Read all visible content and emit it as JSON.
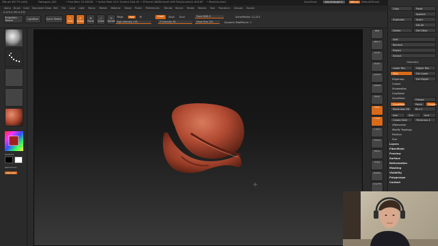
{
  "titlebar": {
    "app_title": "ZBrush 4R7 P3 (x64)",
    "doc_name": "Fatroopan_002",
    "status_items": [
      "• Free Mem 13.035GB",
      "• Active Mem 411",
      "• Scratch Disk 43",
      "• ZTime≡1.684",
      "Timer≡0.043",
      "• PolyCount≡11.618 KP",
      "• MeshCount≡1"
    ],
    "quicksave": "QuickSave",
    "seethrough": "See-through 0",
    "menus_btn": "Menus",
    "defaultzscript": "DefaultZScript"
  },
  "menubar": {
    "items": [
      "Alpha",
      "Brush",
      "Color",
      "Document",
      "Draw",
      "Edit",
      "File",
      "Layer",
      "Light",
      "Macro",
      "Marker",
      "Material",
      "Movie",
      "Picker",
      "Preferences",
      "Render",
      "Stencil",
      "Stroke",
      "Texture",
      "Tool",
      "Transform",
      "Zplugin",
      "Zscript"
    ]
  },
  "coords": "-0.475,0.785,0.378",
  "toolbar": {
    "projection_master": "Projection Master",
    "lightbox": "LightBox",
    "quick_sketch": "Quick Sketch",
    "edit": "Edit",
    "draw": "Draw",
    "move": "Move",
    "scale": "Scale",
    "rotate": "Rotate",
    "mrgb": "Mrgb",
    "rgb": "Rgb",
    "m": "M",
    "zadd": "Zadd",
    "zsub": "Zsub",
    "zcut": "Zcut",
    "rgb_intensity": "Rgb Intensity 100",
    "z_intensity": "Z Intensity 36",
    "focal_shift": "Focal Shift 0",
    "draw_size": "Draw Size 122",
    "dynamic": "Dynamic",
    "active_points": "ActivePoints: 11,213",
    "total_points": "TotalPoints: 1"
  },
  "leftshelf": {
    "gradient": "Gradient",
    "switch_color": "SwitchColor",
    "alternate": "Alternate"
  },
  "rightcol": {
    "icons": [
      "BPR",
      "SPix 3",
      "Scroll",
      "Zoom",
      "Actual",
      "AAHalf",
      "Persp",
      "Floor",
      "Local",
      "L.Sym",
      "Frame",
      "Move",
      "Scale",
      "Rotate",
      "Line Fill",
      "Transp",
      "Ghost",
      "Solo",
      "Xpose"
    ]
  },
  "palette": {
    "top_buttons": [
      "Copy",
      "Paste",
      "Append",
      "Duplicate",
      "Insert",
      "Delete",
      "Del Other",
      "Del All",
      "Split",
      "Remesh",
      "Project",
      "Extract"
    ],
    "geometry": "Geometry",
    "geom_buttons": [
      "Lower Res",
      "Higher Res",
      "SDiv",
      "Del Lower",
      "Del Higher"
    ],
    "edgeloop": "EdgeLoop",
    "crease": "Crease",
    "shadowbox": "ShadowBox",
    "claypolish": "ClayPolish",
    "dynamesh_section": "DynaMesh",
    "dynamesh_btn": "DynaMesh",
    "groups": "Groups",
    "polish": "Polish",
    "blur": "Blur 2",
    "project_btn": "Project",
    "resolution": "Resolution 96",
    "add": "Add",
    "sub": "Sub",
    "and": "And",
    "create_shell": "Create Shell",
    "thickness": "Thickness 4",
    "zremesher": "ZRemesher",
    "modify_topology": "Modify Topology",
    "position": "Position",
    "size": "Size",
    "sections": [
      "Layers",
      "FiberMesh",
      "Preview",
      "Surface",
      "Deformation",
      "Masking",
      "Visibility",
      "Polygroups",
      "Contact"
    ]
  },
  "colors": {
    "accent": "#d86a1a",
    "bg": "#2b2b2b",
    "sculpt": "#b04a32"
  }
}
